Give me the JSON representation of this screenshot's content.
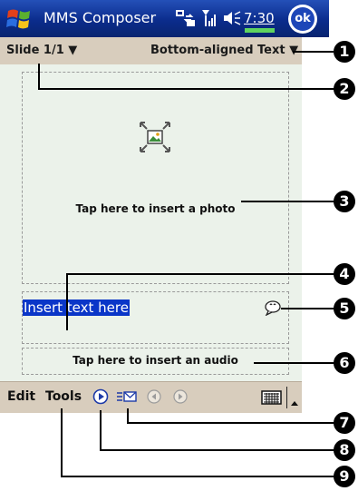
{
  "titlebar": {
    "app_title": "MMS Composer",
    "time": "7:30",
    "ok_label": "ok"
  },
  "toolbar": {
    "slide_label": "Slide 1/1 ▼",
    "layout_label": "Bottom-aligned Text ▼"
  },
  "content": {
    "photo_hint": "Tap here to insert a photo",
    "text_input": "Insert text here",
    "audio_hint": "Tap here to insert an audio"
  },
  "bottombar": {
    "edit_label": "Edit",
    "tools_label": "Tools"
  },
  "callouts": [
    "1",
    "2",
    "3",
    "4",
    "5",
    "6",
    "7",
    "8",
    "9"
  ],
  "icons": {
    "start": "windows-flag-icon",
    "connectivity": "connectivity-icon",
    "signal": "signal-icon",
    "volume": "volume-icon",
    "ok": "ok-button",
    "insert_picture": "insert-picture-icon",
    "insert_smiley": "emoticon-icon",
    "play": "play-icon",
    "slide_list": "slide-list-icon",
    "prev": "previous-slide-icon",
    "next": "next-slide-icon",
    "keyboard": "keyboard-icon",
    "sip_arrow": "sip-arrow-icon"
  }
}
